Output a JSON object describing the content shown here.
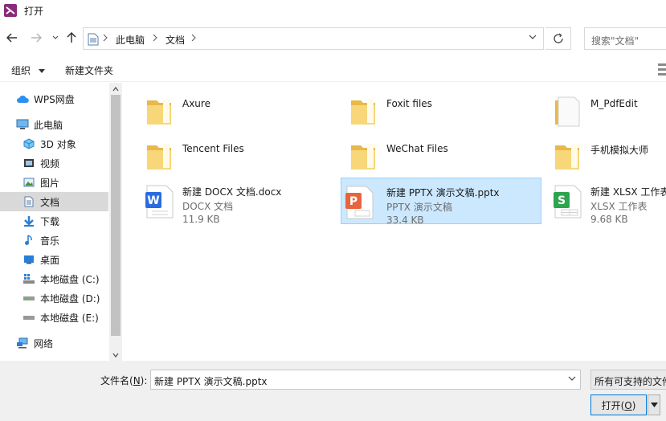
{
  "window": {
    "title": "打开"
  },
  "address": {
    "crumbs": [
      "此电脑",
      "文档"
    ],
    "search_placeholder": "搜索\"文档\""
  },
  "toolbar": {
    "organize": "组织",
    "new_folder": "新建文件夹"
  },
  "nav": {
    "items": [
      {
        "label": "WPS网盘",
        "icon": "cloud-icon"
      },
      {
        "label": "此电脑",
        "icon": "computer-icon"
      },
      {
        "label": "3D 对象",
        "icon": "cube-3d-icon"
      },
      {
        "label": "视频",
        "icon": "video-icon"
      },
      {
        "label": "图片",
        "icon": "picture-icon"
      },
      {
        "label": "文档",
        "icon": "document-icon",
        "selected": true
      },
      {
        "label": "下载",
        "icon": "download-icon"
      },
      {
        "label": "音乐",
        "icon": "music-icon"
      },
      {
        "label": "桌面",
        "icon": "desktop-icon"
      },
      {
        "label": "本地磁盘 (C:)",
        "icon": "system-drive-icon"
      },
      {
        "label": "本地磁盘 (D:)",
        "icon": "drive-icon"
      },
      {
        "label": "本地磁盘 (E:)",
        "icon": "drive-icon"
      },
      {
        "label": "网络",
        "icon": "network-icon"
      }
    ]
  },
  "files": [
    {
      "name": "Axure",
      "kind": "folder"
    },
    {
      "name": "Foxit files",
      "kind": "folder"
    },
    {
      "name": "M_PdfEdit",
      "kind": "folder-doc"
    },
    {
      "name": "Tencent Files",
      "kind": "folder"
    },
    {
      "name": "WeChat Files",
      "kind": "folder"
    },
    {
      "name": "手机模拟大师",
      "kind": "folder"
    },
    {
      "name": "新建 DOCX 文档.docx",
      "type": "DOCX 文档",
      "size": "11.9 KB",
      "kind": "docx"
    },
    {
      "name": "新建 PPTX 演示文稿.pptx",
      "type": "PPTX 演示文稿",
      "size": "33.4 KB",
      "kind": "pptx",
      "selected": true
    },
    {
      "name": "新建 XLSX 工作表",
      "type": "XLSX 工作表",
      "size": "9.68 KB",
      "kind": "xlsx"
    }
  ],
  "footer": {
    "filename_label": "文件名(",
    "filename_key": "N",
    "filename_label_end": "):",
    "filename_value": "新建 PPTX 演示文稿.pptx",
    "filetype_value": "所有可支持的文件",
    "open_label": "打开(",
    "open_key": "O",
    "open_label_end": ")"
  },
  "colors": {
    "selection_bg": "#cce8ff",
    "selection_border": "#99d1ff",
    "folder": "#f3cf6b",
    "wps_docx": "#2b6be0",
    "wps_pptx": "#e8643c",
    "wps_xlsx": "#2da44e"
  }
}
